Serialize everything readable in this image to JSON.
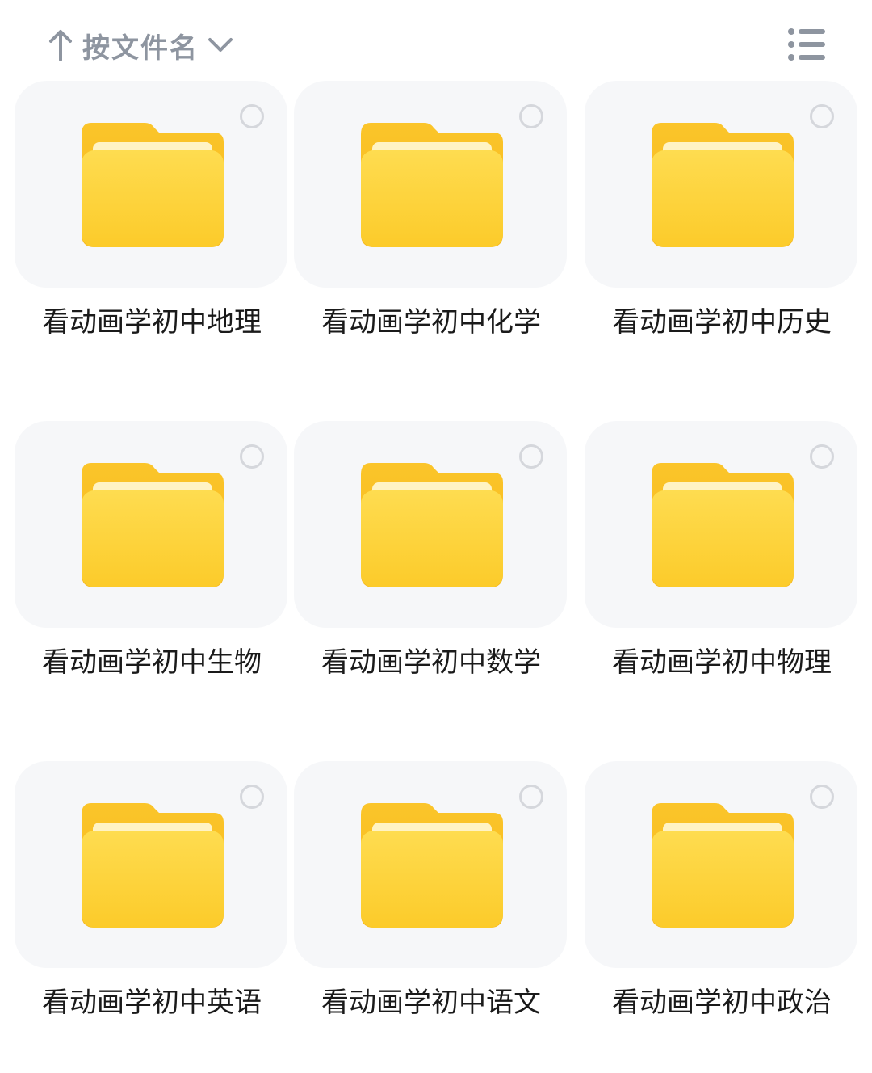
{
  "header": {
    "sort_label": "按文件名",
    "sort_direction_icon": "arrow-up-icon",
    "sort_dropdown_icon": "chevron-down-icon",
    "view_toggle_icon": "list-view-icon"
  },
  "colors": {
    "folder_main": "#fdd23c",
    "folder_back": "#f7c12a",
    "card_background": "#f6f7f9",
    "muted_text": "#8e95a0"
  },
  "folders": [
    {
      "name": "看动画学初中地理",
      "icon": "folder-icon"
    },
    {
      "name": "看动画学初中化学",
      "icon": "folder-icon"
    },
    {
      "name": "看动画学初中历史",
      "icon": "folder-icon"
    },
    {
      "name": "看动画学初中生物",
      "icon": "folder-icon"
    },
    {
      "name": "看动画学初中数学",
      "icon": "folder-icon"
    },
    {
      "name": "看动画学初中物理",
      "icon": "folder-icon"
    },
    {
      "name": "看动画学初中英语",
      "icon": "folder-icon"
    },
    {
      "name": "看动画学初中语文",
      "icon": "folder-icon"
    },
    {
      "name": "看动画学初中政治",
      "icon": "folder-icon"
    }
  ]
}
